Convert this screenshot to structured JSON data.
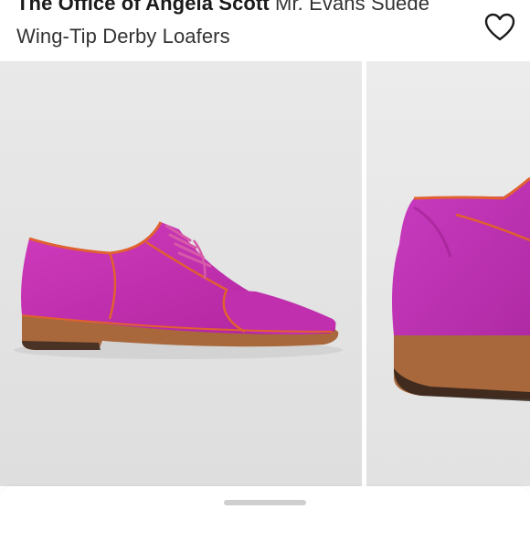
{
  "listing": {
    "brand": "The Office of Angela Scott",
    "product_name": "Mr. Evans Suede Wing-Tip Derby Loafers"
  },
  "icons": {
    "like": "heart-outline-icon"
  },
  "gallery": {
    "images": [
      {
        "alt": "shoe-side-view"
      },
      {
        "alt": "shoe-heel-view"
      }
    ]
  },
  "colors": {
    "suede": "#c42fb0",
    "piping": "#e0612f",
    "sole": "#a9683c",
    "background": "#ececec"
  }
}
